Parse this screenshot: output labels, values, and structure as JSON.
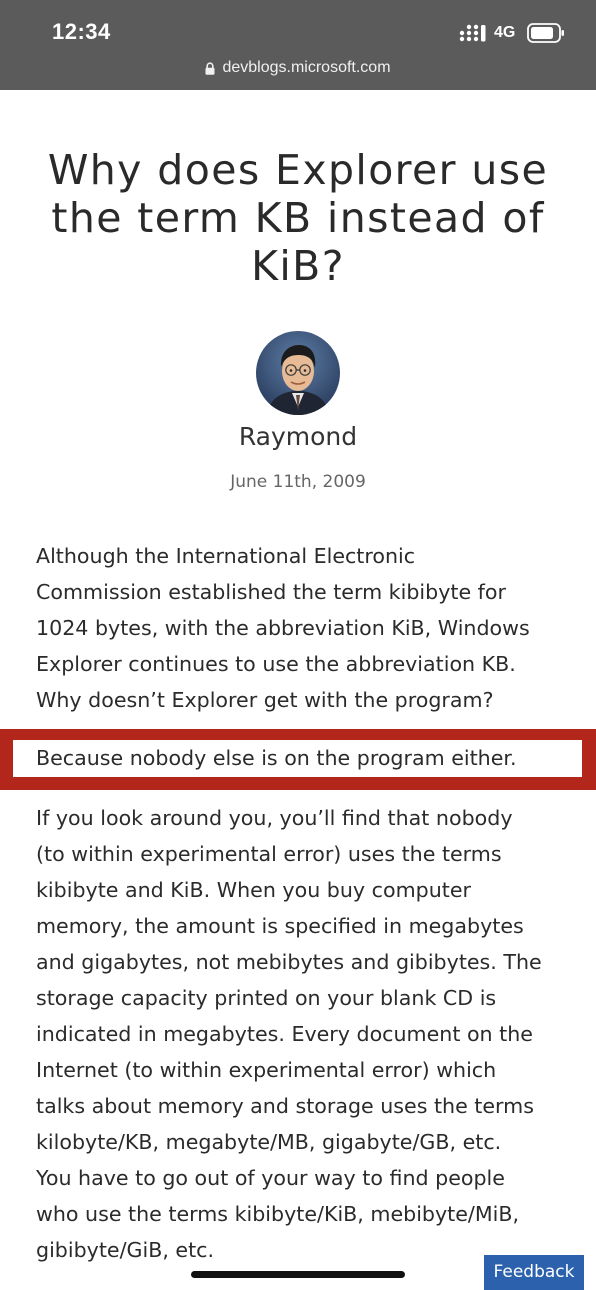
{
  "status_bar": {
    "time": "12:34",
    "network": "4G",
    "icons": [
      "signal-icon",
      "battery-icon"
    ]
  },
  "browser": {
    "url": "devblogs.microsoft.com",
    "url_icon": "lock-icon"
  },
  "article": {
    "title_lines": [
      "Why does Explorer use",
      "the term KB instead of",
      "KiB?"
    ],
    "author": "Raymond",
    "date": "June 11th, 2009",
    "paragraph_1_lines": [
      "Although the International Electronic",
      "Commission established the term kibibyte for",
      "1024 bytes, with the abbreviation KiB, Windows",
      "Explorer continues to use the abbreviation KB.",
      "Why doesn’t Explorer get with the program?"
    ],
    "highlighted_sentence": "Because nobody else is on the program either.",
    "paragraph_2_lines": [
      "If you look around you, you’ll find that nobody",
      "(to within experimental error) uses the terms",
      "kibibyte and KiB. When you buy computer",
      "memory, the amount is specified in megabytes",
      "and gigabytes, not mebibytes and gibibytes. The",
      "storage capacity printed on your blank CD is",
      "indicated in megabytes. Every document on the",
      "Internet (to within experimental error) which",
      "talks about memory and storage uses the terms",
      "kilobyte/KB, megabyte/MB, gigabyte/GB, etc.",
      "You have to go out of your way to find people",
      "who use the terms kibibyte/KiB, mebibyte/MiB,",
      "gibibyte/GiB, etc."
    ]
  },
  "feedback_button": {
    "label": "Feedback"
  },
  "colors": {
    "status_bar_bg": "#5b5b5b",
    "highlight_border": "#b3261b",
    "feedback_bg": "#2c62ad"
  }
}
